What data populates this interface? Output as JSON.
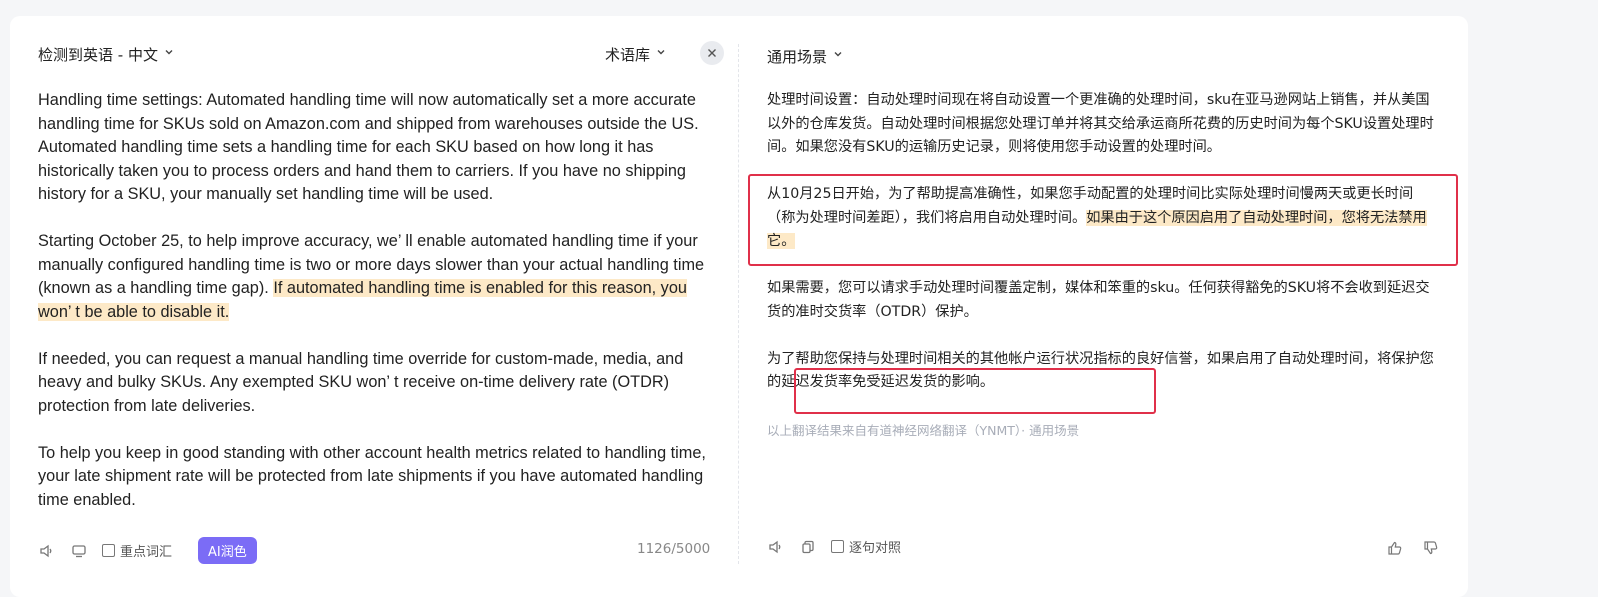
{
  "source": {
    "language_selector": "检测到英语 - 中文",
    "glossary_label": "术语库",
    "paragraphs": [
      {
        "text": "Handling time settings: Automated handling time will now automatically set a more accurate handling time for SKUs sold on Amazon.com and shipped from warehouses outside the US.  Automated handling time sets a handling time for each SKU based on how long it has historically taken you to process orders and hand them to carriers.  If you have no shipping history for a SKU, your manually set handling time will be used.",
        "highlight": ""
      },
      {
        "text": "Starting October 25, to help improve accuracy, we’ ll enable automated handling time if your manually configured handling time is two or more days slower than your actual handling time (known as a handling time gap). ",
        "highlight": "If automated handling time is enabled for this reason, you won’ t be able to disable it."
      },
      {
        "text": "If needed, you can request a manual handling time override for custom-made, media, and heavy and bulky SKUs.  Any exempted SKU won’ t receive on-time delivery rate (OTDR) protection from late deliveries.",
        "highlight": ""
      },
      {
        "text": "To help you keep in good standing with other account health metrics related to handling time, your late shipment rate will be protected from late shipments if you have automated handling time enabled.",
        "highlight": ""
      }
    ],
    "toolbar": {
      "key_terms_label": "重点词汇",
      "ai_polish_label": "AI润色",
      "char_count": "1126/5000"
    }
  },
  "target": {
    "scenario_selector": "通用场景",
    "paragraphs": [
      {
        "text": "处理时间设置：自动处理时间现在将自动设置一个更准确的处理时间，sku在亚马逊网站上销售，并从美国以外的仓库发货。自动处理时间根据您处理订单并将其交给承运商所花费的历史时间为每个SKU设置处理时间。如果您没有SKU的运输历史记录，则将使用您手动设置的处理时间。",
        "highlight": ""
      },
      {
        "text": "从10月25日开始，为了帮助提高准确性，如果您手动配置的处理时间比实际处理时间慢两天或更长时间（称为处理时间差距），我们将启用自动处理时间。",
        "highlight": "如果由于这个原因启用了自动处理时间，您将无法禁用它。"
      },
      {
        "text": "如果需要，您可以请求手动处理时间覆盖定制，媒体和笨重的sku。任何获得豁免的SKU将不会收到延迟交货的准时交货率（OTDR）保护。",
        "highlight": ""
      },
      {
        "text": "为了帮助您保持与处理时间相关的其他帐户运行状况指标的良好信誉，如果启用了自动处理时间，将保护您的延迟发货率免受延迟发货的影响。",
        "highlight": ""
      }
    ],
    "credit": "以上翻译结果来自有道神经网络翻译（YNMT）· 通用场景",
    "toolbar": {
      "sentence_align_label": "逐句对照"
    }
  },
  "icons": {
    "speaker": "speaker-icon",
    "copy": "copy-icon",
    "close": "close-icon",
    "thumbs_up": "thumbs-up-icon",
    "thumbs_down": "thumbs-down-icon",
    "chevron": "chevron-down-icon"
  },
  "colors": {
    "highlight": "#fde9c7",
    "ai_button": "#7b6cf6",
    "annotation_box": "#e0304a"
  }
}
